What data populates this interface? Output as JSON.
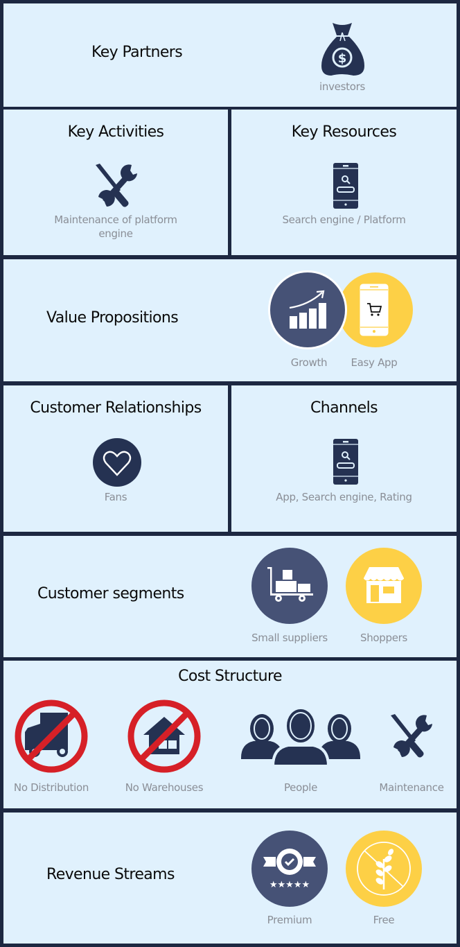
{
  "colors": {
    "border": "#1d2841",
    "panel": "#e0f1fd",
    "icon_dark": "#253252",
    "circle_navy": "#465276",
    "circle_yellow": "#fdd046",
    "prohibit_red": "#d62027",
    "label_gray": "#8a8e96"
  },
  "key_partners": {
    "title": "Key Partners",
    "items": [
      {
        "label": "investors",
        "icon": "money-bag-icon"
      }
    ]
  },
  "key_activities": {
    "title": "Key Activities",
    "items": [
      {
        "label_line1": "Maintenance of platform",
        "label_line2": "engine",
        "icon": "tools-icon"
      }
    ]
  },
  "key_resources": {
    "title": "Key Resources",
    "items": [
      {
        "label": "Search engine / Platform",
        "icon": "phone-search-icon"
      }
    ]
  },
  "value_propositions": {
    "title": "Value Propositions",
    "items": [
      {
        "label": "Growth",
        "icon": "growth-chart-icon"
      },
      {
        "label": "Easy App",
        "icon": "phone-cart-icon"
      }
    ]
  },
  "customer_relationships": {
    "title": "Customer Relationships",
    "items": [
      {
        "label": "Fans",
        "icon": "heart-icon"
      }
    ]
  },
  "channels": {
    "title": "Channels",
    "items": [
      {
        "label": "App, Search engine, Rating",
        "icon": "phone-search-icon"
      }
    ]
  },
  "customer_segments": {
    "title": "Customer segments",
    "items": [
      {
        "label": "Small suppliers",
        "icon": "hand-truck-icon"
      },
      {
        "label": "Shoppers",
        "icon": "store-icon"
      }
    ]
  },
  "cost_structure": {
    "title": "Cost Structure",
    "items": [
      {
        "label": "No Distribution",
        "icon": "no-truck-icon"
      },
      {
        "label": "No Warehouses",
        "icon": "no-warehouse-icon"
      },
      {
        "label": "People",
        "icon": "people-icon"
      },
      {
        "label": "Maintenance",
        "icon": "tools-icon"
      }
    ]
  },
  "revenue_streams": {
    "title": "Revenue Streams",
    "items": [
      {
        "label": "Premium",
        "icon": "premium-badge-icon"
      },
      {
        "label": "Free",
        "icon": "no-wheat-icon"
      }
    ]
  }
}
